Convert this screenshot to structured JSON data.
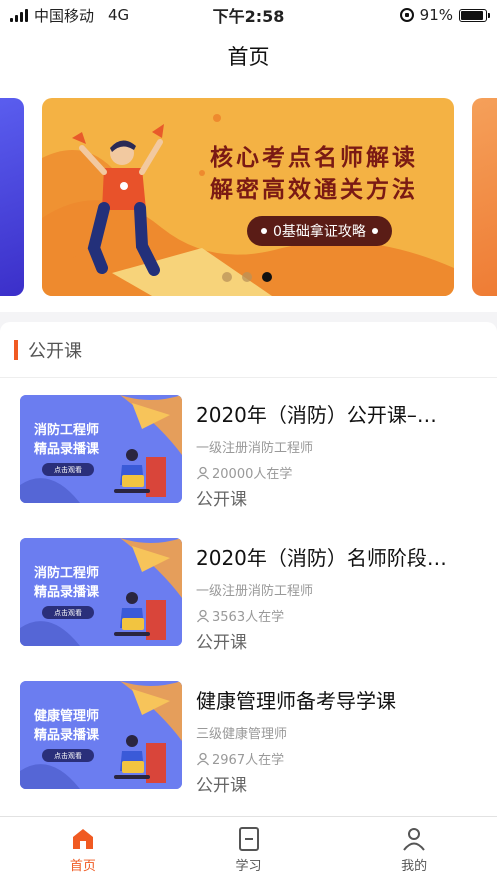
{
  "status_bar": {
    "carrier": "中国移动",
    "network": "4G",
    "time": "下午2:58",
    "battery_percent": "91%",
    "battery_level": 0.91
  },
  "header": {
    "title": "首页"
  },
  "banner": {
    "headline_line1": "核心考点名师解读",
    "headline_line2": "解密高效通关方法",
    "pill_label": "0基础拿证攻略",
    "active_slide": 3,
    "slide_count": 3
  },
  "section": {
    "title": "公开课"
  },
  "courses": [
    {
      "thumb_title_line1": "消防工程师",
      "thumb_title_line2": "精品录播课",
      "thumb_button": "点击观看",
      "title": "2020年（消防）公开课–…",
      "subtitle": "一级注册消防工程师",
      "learners": "20000人在学",
      "type": "公开课"
    },
    {
      "thumb_title_line1": "消防工程师",
      "thumb_title_line2": "精品录播课",
      "thumb_button": "点击观看",
      "title": "2020年（消防）名师阶段…",
      "subtitle": "一级注册消防工程师",
      "learners": "3563人在学",
      "type": "公开课"
    },
    {
      "thumb_title_line1": "健康管理师",
      "thumb_title_line2": "精品录播课",
      "thumb_button": "点击观看",
      "title": "健康管理师备考导学课",
      "subtitle": "三级健康管理师",
      "learners": "2967人在学",
      "type": "公开课"
    }
  ],
  "tabs": [
    {
      "label": "首页",
      "icon": "home-icon",
      "active": true
    },
    {
      "label": "学习",
      "icon": "study-icon",
      "active": false
    },
    {
      "label": "我的",
      "icon": "profile-icon",
      "active": false
    }
  ],
  "colors": {
    "accent": "#f05a22",
    "banner_bg": "#f4b244",
    "banner_text": "#7a1a14",
    "thumb_bg": "#6b7df0"
  }
}
